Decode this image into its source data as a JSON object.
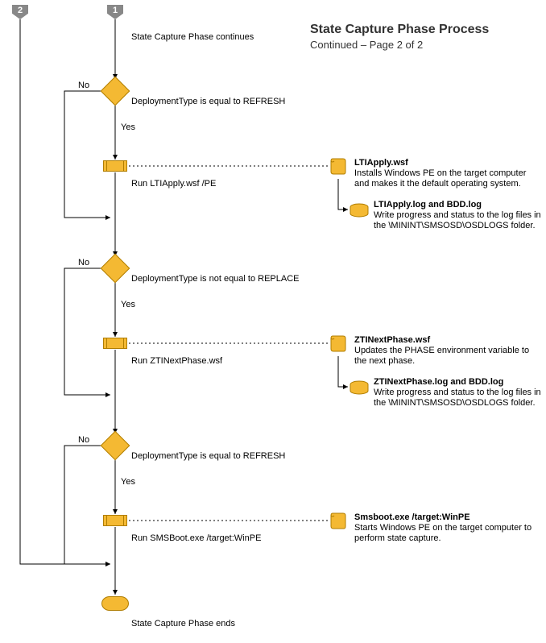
{
  "connectors": {
    "two": "2",
    "one": "1"
  },
  "header": {
    "title": "State Capture Phase Process",
    "subtitle": "Continued – Page 2 of 2"
  },
  "start_text": "State Capture Phase continues",
  "decisions": {
    "d1": {
      "no": "No",
      "yes": "Yes",
      "text": "DeploymentType is equal to REFRESH"
    },
    "d2": {
      "no": "No",
      "yes": "Yes",
      "text": "DeploymentType is not equal to REPLACE"
    },
    "d3": {
      "no": "No",
      "yes": "Yes",
      "text": "DeploymentType is equal to REFRESH"
    }
  },
  "processes": {
    "p1": "Run LTIApply.wsf /PE",
    "p2": "Run ZTINextPhase.wsf",
    "p3": "Run SMSBoot.exe /target:WinPE"
  },
  "annotations": {
    "a1_scroll": {
      "title": "LTIApply.wsf",
      "desc": "Installs Windows PE on the target computer and makes it the default operating system."
    },
    "a1_db": {
      "title": "LTIApply.log and BDD.log",
      "desc": "Write progress and status to the log files in the \\MININT\\SMSOSD\\OSDLOGS folder."
    },
    "a2_scroll": {
      "title": "ZTINextPhase.wsf",
      "desc": "Updates the PHASE environment variable to the next phase."
    },
    "a2_db": {
      "title": "ZTINextPhase.log and BDD.log",
      "desc": "Write progress and status to the log files in the \\MININT\\SMSOSD\\OSDLOGS folder."
    },
    "a3_scroll": {
      "title": "Smsboot.exe /target:WinPE",
      "desc": "Starts Windows PE on the target computer to perform state capture."
    }
  },
  "end_text": "State Capture Phase ends",
  "chart_data": {
    "type": "flowchart",
    "title": "State Capture Phase Process — Continued – Page 2 of 2",
    "nodes": [
      {
        "id": "conn2",
        "type": "offpage-connector",
        "label": "2"
      },
      {
        "id": "conn1",
        "type": "offpage-connector",
        "label": "1"
      },
      {
        "id": "start",
        "type": "text",
        "label": "State Capture Phase continues"
      },
      {
        "id": "d1",
        "type": "decision",
        "label": "DeploymentType is equal to REFRESH"
      },
      {
        "id": "p1",
        "type": "process",
        "label": "Run LTIApply.wsf /PE"
      },
      {
        "id": "d2",
        "type": "decision",
        "label": "DeploymentType is not equal to REPLACE"
      },
      {
        "id": "p2",
        "type": "process",
        "label": "Run ZTINextPhase.wsf"
      },
      {
        "id": "d3",
        "type": "decision",
        "label": "DeploymentType is equal to REFRESH"
      },
      {
        "id": "p3",
        "type": "process",
        "label": "Run SMSBoot.exe /target:WinPE"
      },
      {
        "id": "end",
        "type": "terminator",
        "label": "State Capture Phase ends"
      },
      {
        "id": "ann1a",
        "type": "annotation",
        "icon": "scroll",
        "title": "LTIApply.wsf",
        "desc": "Installs Windows PE on the target computer and makes it the default operating system."
      },
      {
        "id": "ann1b",
        "type": "annotation",
        "icon": "database",
        "title": "LTIApply.log and BDD.log",
        "desc": "Write progress and status to the log files in the \\MININT\\SMSOSD\\OSDLOGS folder."
      },
      {
        "id": "ann2a",
        "type": "annotation",
        "icon": "scroll",
        "title": "ZTINextPhase.wsf",
        "desc": "Updates the PHASE environment variable to the next phase."
      },
      {
        "id": "ann2b",
        "type": "annotation",
        "icon": "database",
        "title": "ZTINextPhase.log and BDD.log",
        "desc": "Write progress and status to the log files in the \\MININT\\SMSOSD\\OSDLOGS folder."
      },
      {
        "id": "ann3a",
        "type": "annotation",
        "icon": "scroll",
        "title": "Smsboot.exe /target:WinPE",
        "desc": "Starts Windows PE on the target computer to perform state capture."
      }
    ],
    "edges": [
      {
        "from": "conn1",
        "to": "d1"
      },
      {
        "from": "d1",
        "to": "p1",
        "label": "Yes"
      },
      {
        "from": "d1",
        "to": "merge1",
        "label": "No"
      },
      {
        "from": "p1",
        "to": "d2"
      },
      {
        "from": "d2",
        "to": "p2",
        "label": "Yes"
      },
      {
        "from": "d2",
        "to": "merge2",
        "label": "No"
      },
      {
        "from": "p2",
        "to": "d3"
      },
      {
        "from": "d3",
        "to": "p3",
        "label": "Yes"
      },
      {
        "from": "d3",
        "to": "merge3",
        "label": "No"
      },
      {
        "from": "p3",
        "to": "end"
      },
      {
        "from": "conn2",
        "to": "end"
      },
      {
        "from": "p1",
        "to": "ann1a",
        "style": "dashed"
      },
      {
        "from": "ann1a",
        "to": "ann1b"
      },
      {
        "from": "p2",
        "to": "ann2a",
        "style": "dashed"
      },
      {
        "from": "ann2a",
        "to": "ann2b"
      },
      {
        "from": "p3",
        "to": "ann3a",
        "style": "dashed"
      }
    ]
  }
}
